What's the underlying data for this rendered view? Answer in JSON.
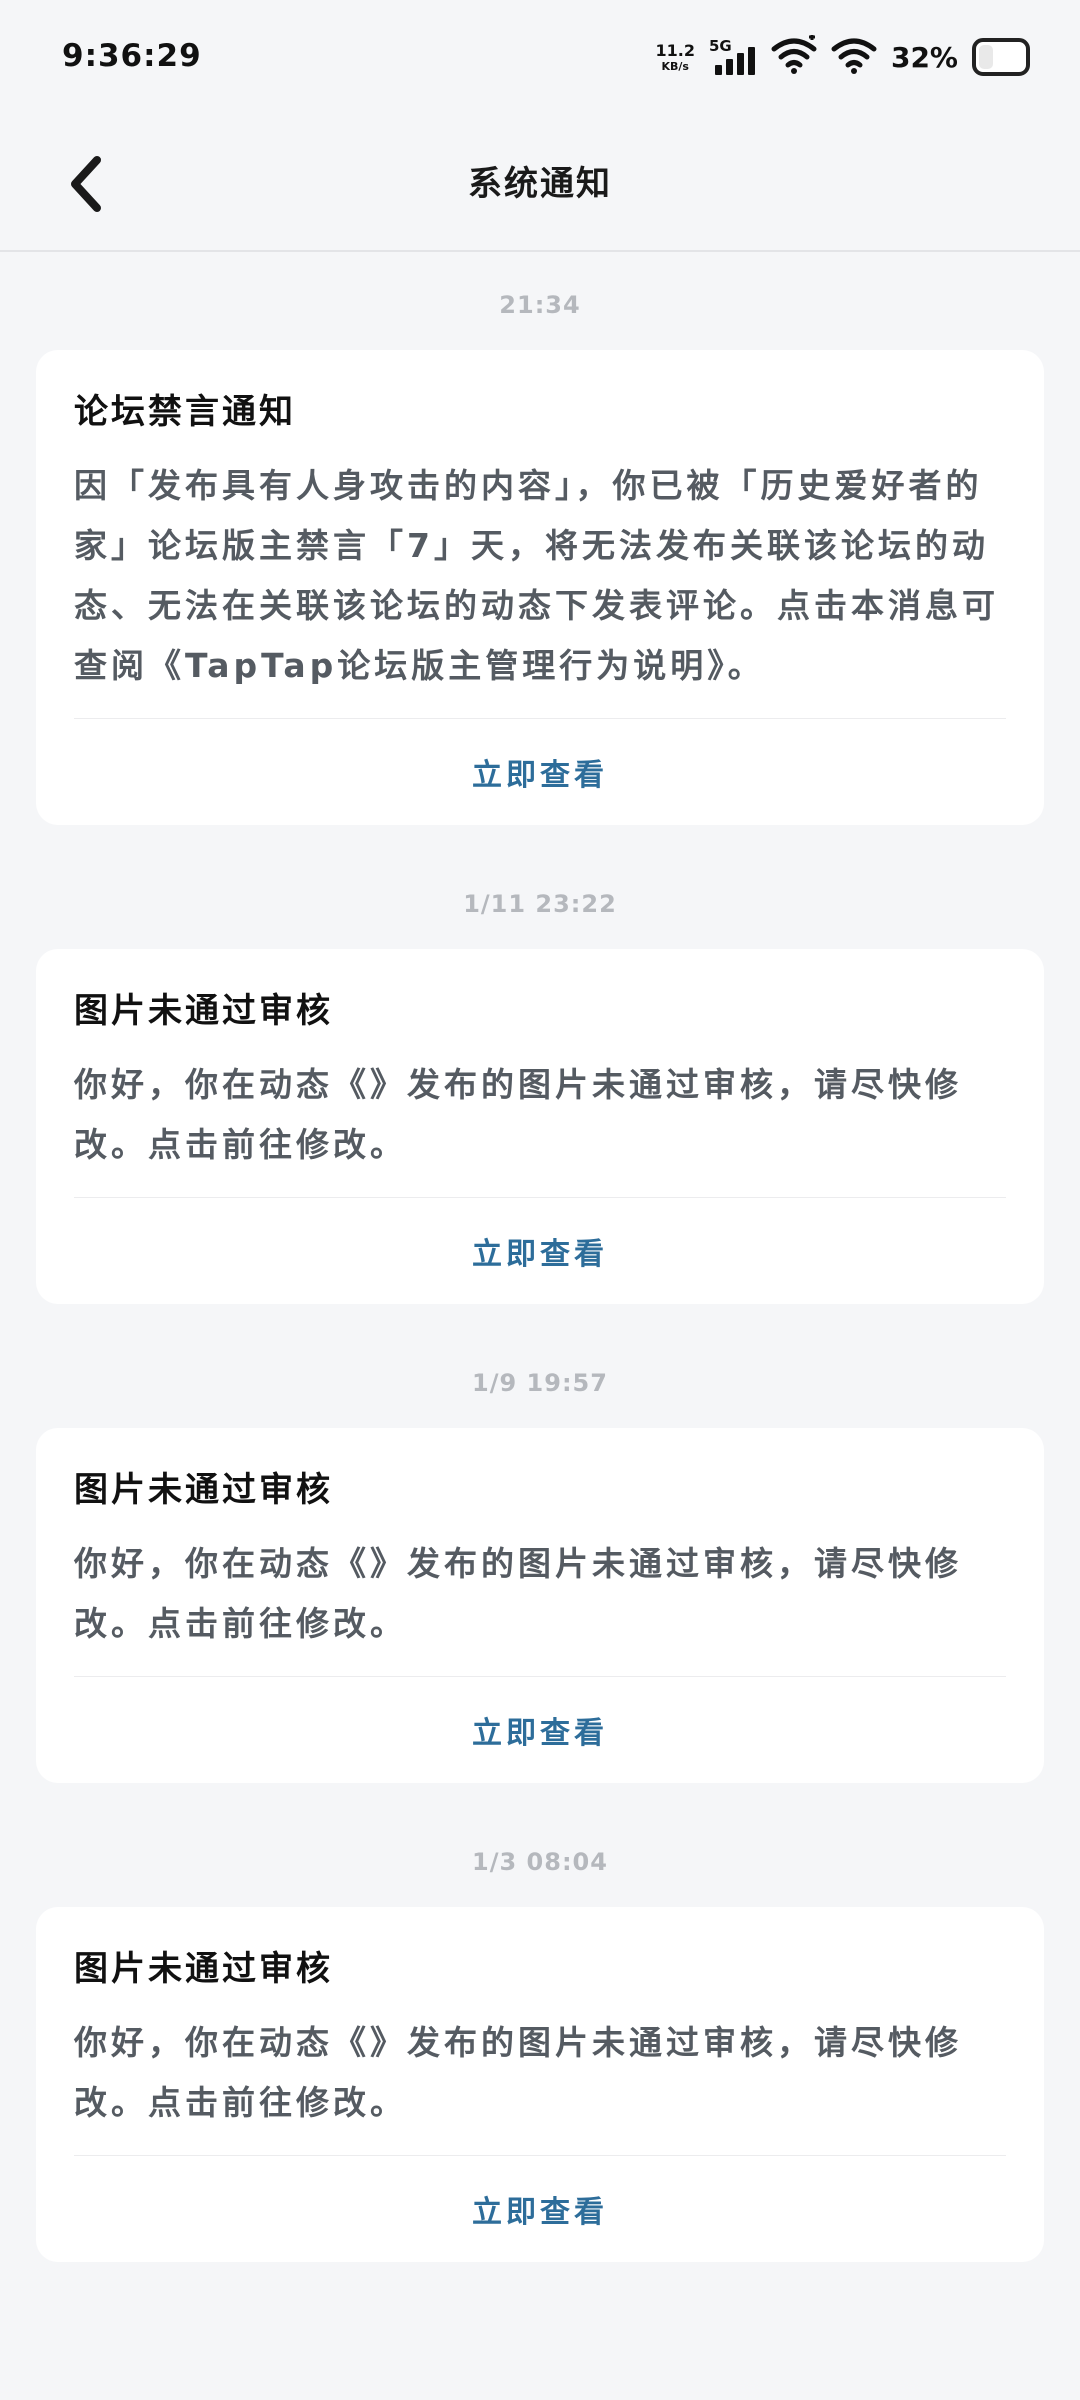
{
  "status_bar": {
    "time": "9:36:29",
    "net_speed_value": "11.2",
    "net_speed_unit": "KB/s",
    "network_type": "5G",
    "battery_percent": "32%",
    "battery_level": 0.32
  },
  "header": {
    "title": "系统通知",
    "back_icon": "chevron-left-icon"
  },
  "notifications": [
    {
      "time": "21:34",
      "title": "论坛禁言通知",
      "body": "因「发布具有人身攻击的内容」，你已被「历史爱好者的家」论坛版主禁言「7」天，将无法发布关联该论坛的动态、无法在关联该论坛的动态下发表评论。点击本消息可查阅《TapTap论坛版主管理行为说明》。",
      "action": "立即查看"
    },
    {
      "time": "1/11  23:22",
      "title": "图片未通过审核",
      "body": "你好，你在动态《》发布的图片未通过审核，请尽快修改。点击前往修改。",
      "action": "立即查看"
    },
    {
      "time": "1/9  19:57",
      "title": "图片未通过审核",
      "body": "你好，你在动态《》发布的图片未通过审核，请尽快修改。点击前往修改。",
      "action": "立即查看"
    },
    {
      "time": "1/3  08:04",
      "title": "图片未通过审核",
      "body": "你好，你在动态《》发布的图片未通过审核，请尽快修改。点击前往修改。",
      "action": "立即查看"
    }
  ],
  "colors": {
    "background": "#f5f6f8",
    "card": "#ffffff",
    "action_link": "#2d6d9a",
    "timestamp": "#b5b8bd"
  }
}
